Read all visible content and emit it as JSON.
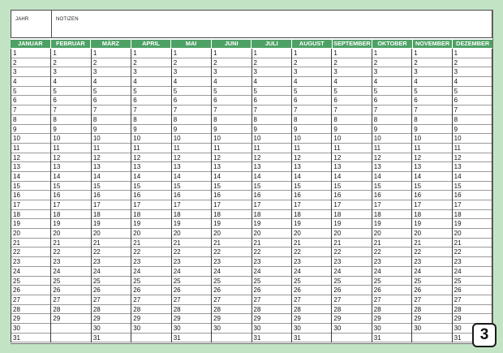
{
  "header": {
    "year_label": "JAHR",
    "notes_label": "NOTIZEN"
  },
  "months": [
    {
      "name": "JANUAR",
      "days": 31
    },
    {
      "name": "FEBRUAR",
      "days": 29
    },
    {
      "name": "MÄRZ",
      "days": 31
    },
    {
      "name": "APRIL",
      "days": 30
    },
    {
      "name": "MAI",
      "days": 31
    },
    {
      "name": "JUNI",
      "days": 30
    },
    {
      "name": "JULI",
      "days": 31
    },
    {
      "name": "AUGUST",
      "days": 31
    },
    {
      "name": "SEPTEMBER",
      "days": 30
    },
    {
      "name": "OKTOBER",
      "days": 31
    },
    {
      "name": "NOVEMBER",
      "days": 30
    },
    {
      "name": "DEZEMBER",
      "days": 31
    }
  ],
  "page_number": "3",
  "colors": {
    "header_green": "#4ea165",
    "background_green": "#c3e3c5"
  }
}
